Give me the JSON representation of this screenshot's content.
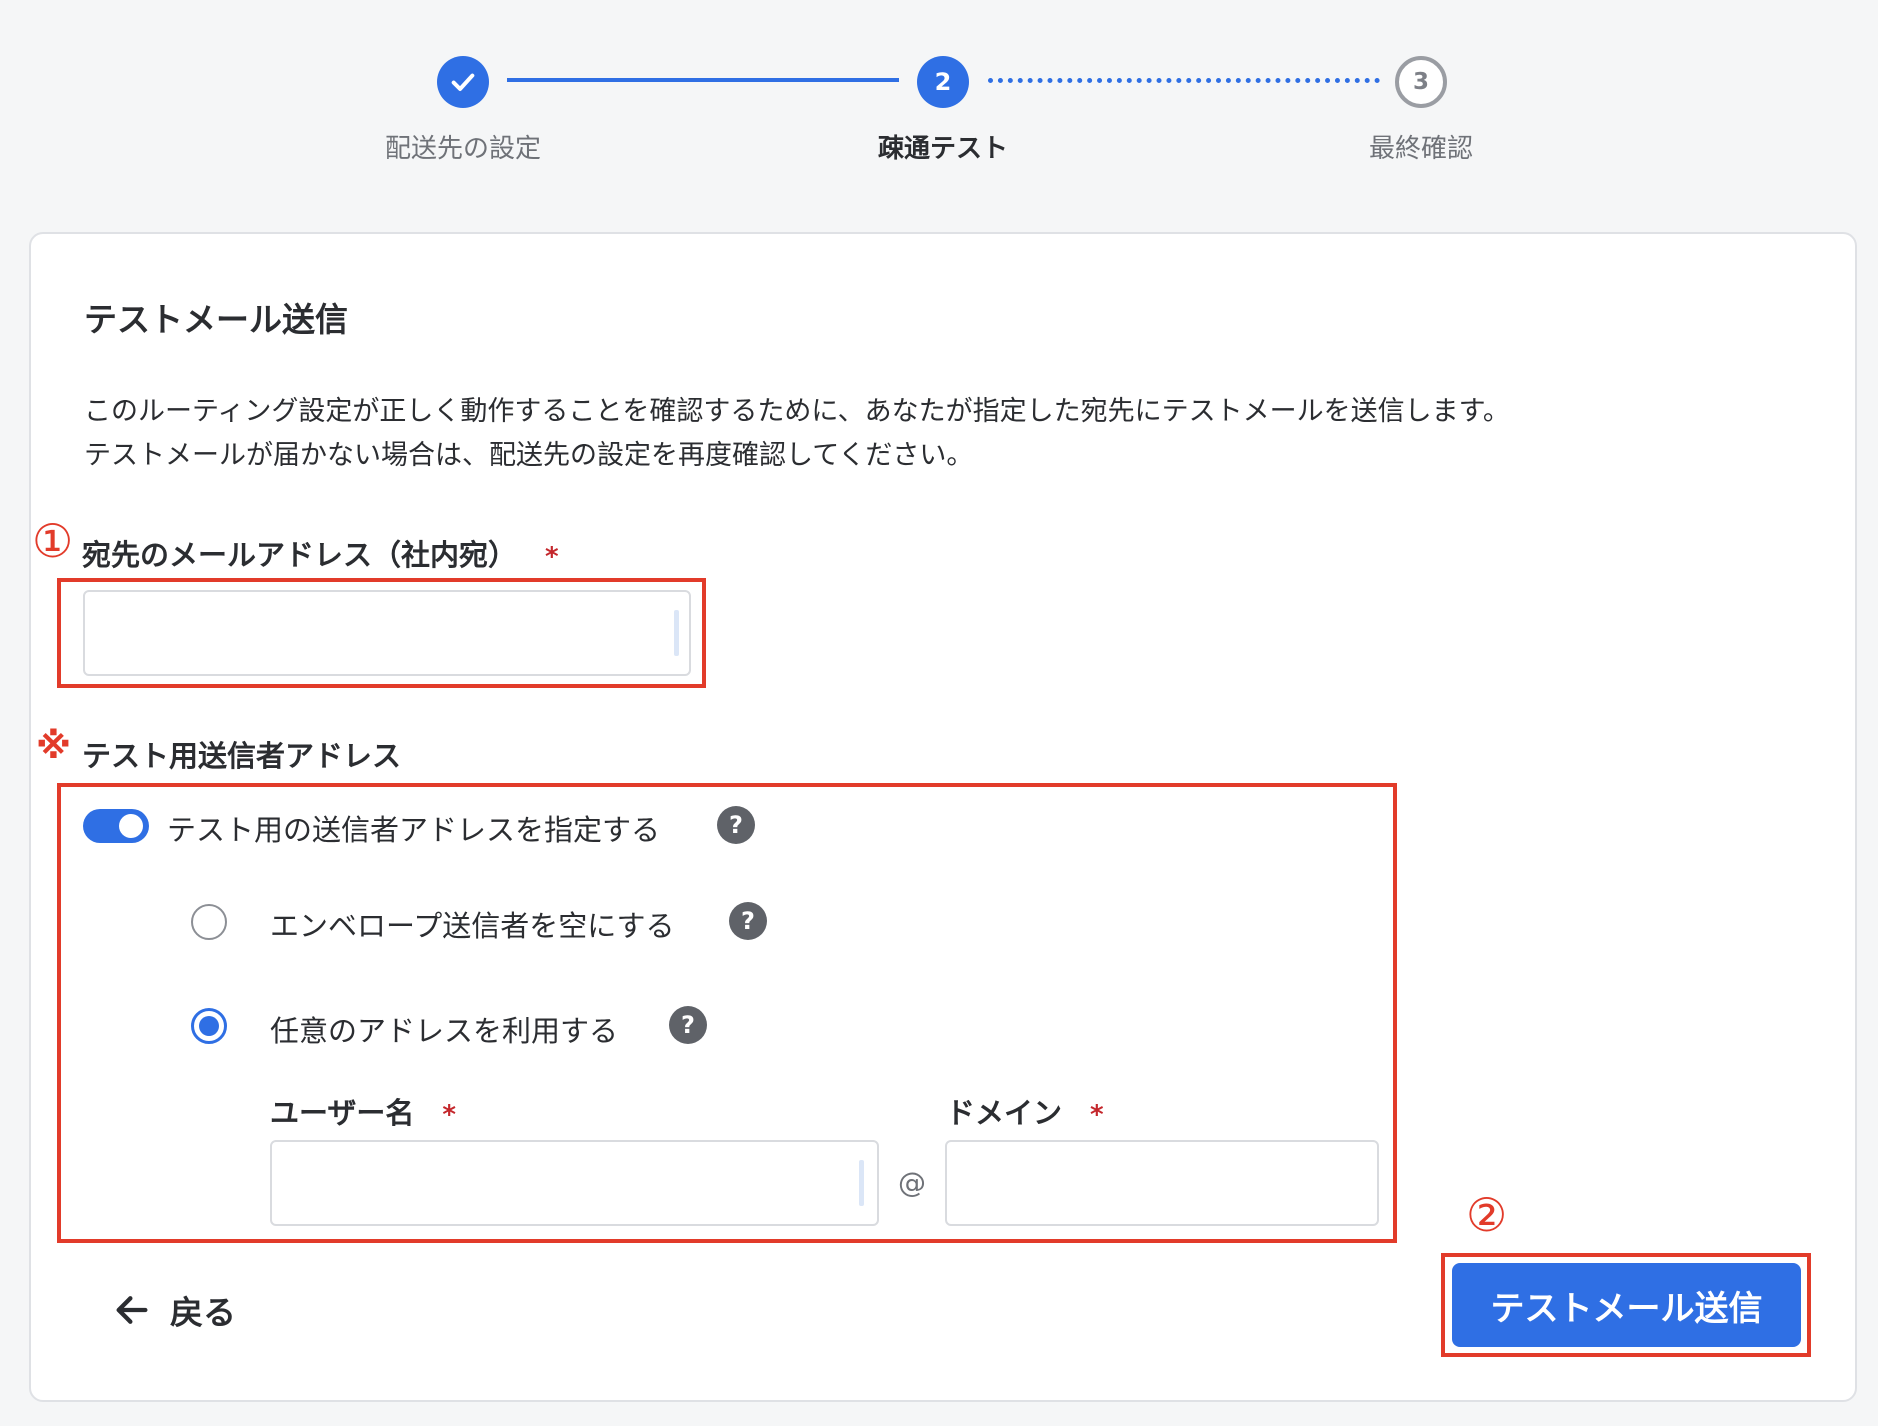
{
  "stepper": {
    "steps": [
      {
        "label": "配送先の設定",
        "state": "done"
      },
      {
        "label": "疎通テスト",
        "number": "2",
        "state": "current"
      },
      {
        "label": "最終確認",
        "number": "3",
        "state": "todo"
      }
    ]
  },
  "form": {
    "section_title": "テストメール送信",
    "description_line1": "このルーティング設定が正しく動作することを確認するために、あなたが指定した宛先にテストメールを送信します。",
    "description_line2": "テストメールが届かない場合は、配送先の設定を再度確認してください。",
    "recipient": {
      "label": "宛先のメールアドレス（社内宛）",
      "required_mark": "*",
      "value": "",
      "annotation": "①"
    },
    "sender": {
      "annotation": "※",
      "label": "テスト用送信者アドレス",
      "toggle_label": "テスト用の送信者アドレスを指定する",
      "toggle_on": true,
      "options": [
        {
          "label": "エンベロープ送信者を空にする",
          "selected": false
        },
        {
          "label": "任意のアドレスを利用する",
          "selected": true
        }
      ],
      "username_label": "ユーザー名",
      "domain_label": "ドメイン",
      "required_mark": "*",
      "username_value": "",
      "domain_value": "",
      "at_symbol": "@"
    },
    "help_symbol": "?"
  },
  "footer": {
    "back_label": "戻る",
    "submit_label": "テストメール送信",
    "submit_annotation": "②"
  },
  "colors": {
    "accent": "#2f6fe4",
    "annotation_red": "#e23b2a",
    "required_red": "#c4272c"
  }
}
